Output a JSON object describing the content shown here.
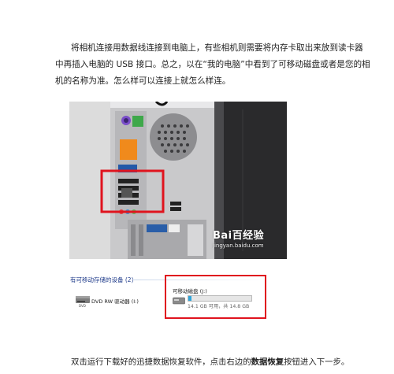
{
  "intro_paragraph": "将相机连接用数据线连接到电脑上，有些相机则需要将内存卡取出来放到读卡器中再插入电脑的 USB 接口。总之，以在“我的电脑”中看到了可移动磁盘或者是您的相机的名称为准。怎么样可以连接上就怎么样连。",
  "photo": {
    "watermark_logo": "Bai百经验",
    "watermark_url": "jingyan.baidu.com",
    "highlight_color": "#e0141e"
  },
  "explorer": {
    "section_header": "有可移动存储的设备 (2)",
    "dvd_drive_label": "DVD RW 驱动器 (I:)",
    "removable_disk_title": "可移动磁盘 (J:)",
    "removable_disk_usage_fraction": 0.05,
    "removable_disk_size_text": "14.1 GB 可用，共 14.8 GB"
  },
  "step_paragraph": {
    "before": "双击运行下载好的迅捷数据恢复软件，点击右边的",
    "bold": "数据恢复",
    "after": "按钮进入下一步。"
  }
}
